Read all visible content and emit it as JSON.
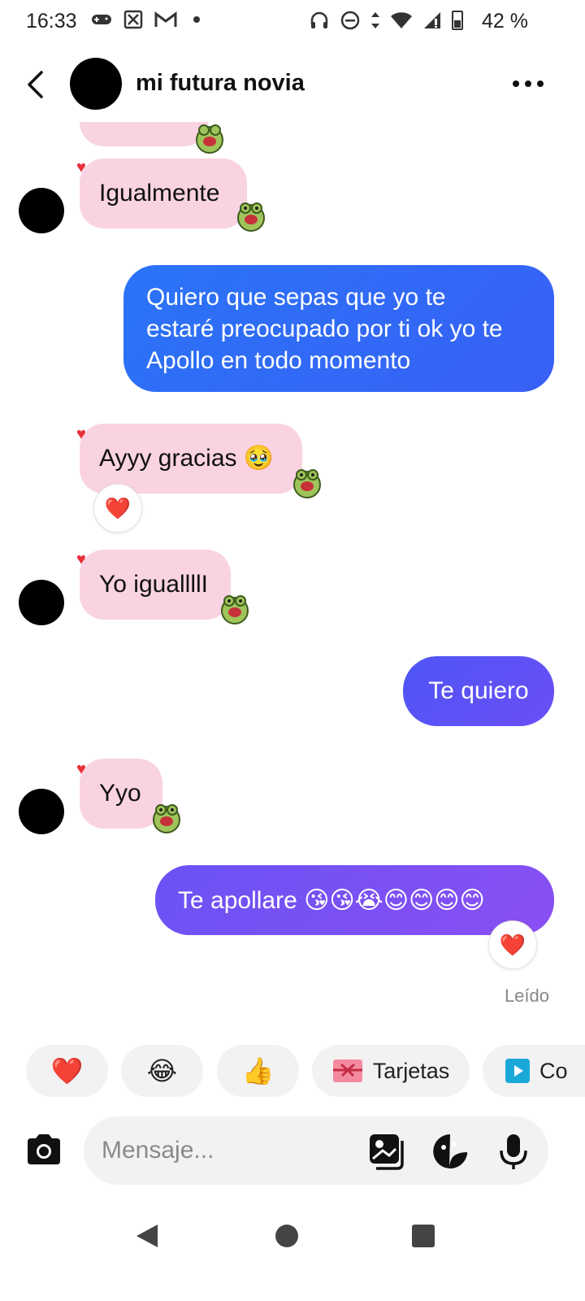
{
  "status_bar": {
    "time": "16:33",
    "battery": "42 %",
    "left_icons": [
      "gamepad-icon",
      "app-icon",
      "gmail-icon",
      "dot-icon"
    ],
    "right_icons": [
      "headphones-icon",
      "dnd-icon",
      "data-arrows-icon",
      "wifi-icon",
      "signal-icon",
      "battery-icon"
    ]
  },
  "header": {
    "title": "mi futura novia"
  },
  "messages": {
    "m1": {
      "text": "Igualmente",
      "from": "them"
    },
    "m2": {
      "text": "Quiero que sepas que yo te estaré preocupado por ti ok yo te Apollo en todo momento",
      "line1": "Quiero que sepas que yo te",
      "line2": "estaré preocupado por ti ok yo te",
      "line3": "Apollo en todo momento",
      "from": "me"
    },
    "m3": {
      "text": "Ayyy gracias 🥹",
      "from": "them",
      "reaction": "❤️"
    },
    "m4": {
      "text": "Yo iguallllI",
      "from": "them"
    },
    "m5": {
      "text": "Te quiero",
      "from": "me"
    },
    "m6": {
      "text": "Yyo",
      "from": "them"
    },
    "m7": {
      "text": "Te apollare 😘😘😭😊😊😊😊",
      "from": "me",
      "reaction": "❤️"
    }
  },
  "read_receipt": "Leído",
  "quick_replies": {
    "heart": "❤️",
    "laugh": "😂",
    "thumbs": "👍",
    "cards": "Tarjetas",
    "co": "Co"
  },
  "composer": {
    "placeholder": "Mensaje..."
  },
  "colors": {
    "incoming_bubble": "#f9d3e1",
    "outgoing_blue": "#2f6cf6",
    "outgoing_purple": "#6b52f5",
    "heart": "#e8303b"
  }
}
